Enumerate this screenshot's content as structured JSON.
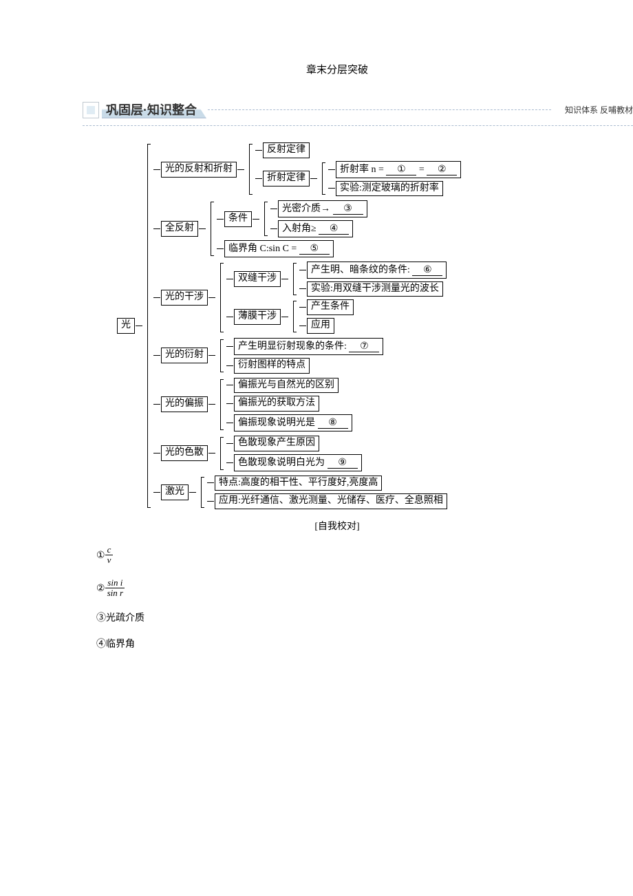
{
  "doc_title": "章末分层突破",
  "banner": {
    "main": "巩固层·知识整合",
    "tail": "知识体系  反哺教材"
  },
  "root": "光",
  "s1": {
    "label": "光的反射和折射",
    "a": "反射定律",
    "b": "折射定律",
    "b1_pre": "折射率 n =",
    "b1_c1": "①",
    "b1_eq": "=",
    "b1_c2": "②",
    "b2": "实验:测定玻璃的折射率"
  },
  "s2": {
    "label": "全反射",
    "cond": "条件",
    "c1_pre": "光密介质→",
    "c1_blank": "③",
    "c2_pre": "入射角≥",
    "c2_blank": "④",
    "crit_pre": "临界角 C:sin C =",
    "crit_blank": "⑤"
  },
  "s3": {
    "label": "光的干涉",
    "a": "双缝干涉",
    "a1_pre": "产生明、暗条纹的条件:",
    "a1_blank": "⑥",
    "a2": "实验:用双缝干涉测量光的波长",
    "b": "薄膜干涉",
    "b1": "产生条件",
    "b2": "应用"
  },
  "s4": {
    "label": "光的衍射",
    "a_pre": "产生明显衍射现象的条件:",
    "a_blank": "⑦",
    "b": "衍射图样的特点"
  },
  "s5": {
    "label": "光的偏振",
    "a": "偏振光与自然光的区别",
    "b": "偏振光的获取方法",
    "c_pre": "偏振现象说明光是",
    "c_blank": "⑧"
  },
  "s6": {
    "label": "光的色散",
    "a": "色散现象产生原因",
    "b_pre": "色散现象说明白光为",
    "b_blank": "⑨"
  },
  "s7": {
    "label": "激光",
    "a": "特点:高度的相干性、平行度好,亮度高",
    "b": "应用:光纤通信、激光测量、光储存、医疗、全息照相"
  },
  "self_check": "[自我校对]",
  "answers": {
    "a1_sym": "①",
    "a1_num": "c",
    "a1_den": "v",
    "a2_sym": "②",
    "a2_num": "sin i",
    "a2_den": "sin r",
    "a3": "③光疏介质",
    "a4": "④临界角"
  }
}
